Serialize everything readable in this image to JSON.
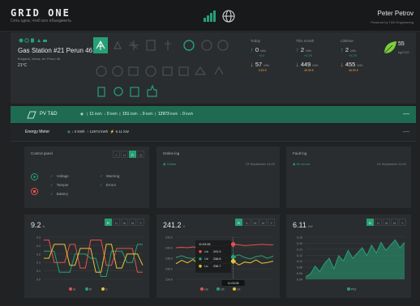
{
  "header": {
    "brand": "GRID ONE",
    "tagline": "Сеть одна, чтоб все объединить",
    "user_name": "Peter Petrov",
    "user_sub": "Powered by T&D Engineering"
  },
  "station": {
    "title": "Gas Station #21 Perun 46",
    "address": "Bulgaria, Varna, str. Perun 46",
    "temperature": "21°C"
  },
  "stats": [
    {
      "label": "Today",
      "in_value": "0",
      "in_unit": "kWh",
      "in_delta": "+0.0",
      "out_value": "57",
      "out_unit": "kWh",
      "out_delta": "5.83 €"
    },
    {
      "label": "This month",
      "in_value": "2",
      "in_unit": "kWh",
      "in_delta": "+0.2 €",
      "out_value": "449",
      "out_unit": "kWh",
      "out_delta": "45.95 €"
    },
    {
      "label": "Lifetime",
      "in_value": "2",
      "in_unit": "kWh",
      "in_delta": "+0.2 €",
      "out_value": "455",
      "out_unit": "kWh",
      "out_delta": "46.53 €"
    }
  ],
  "co2": {
    "value": "55",
    "unit": "kg/CO2"
  },
  "pv": {
    "title": "PV T&D",
    "m1": "11",
    "m1u": "kWh",
    "m2": "0",
    "m2u": "kWh",
    "m3": "151",
    "m3u": "kWh",
    "m4": "0",
    "m4u": "kWh",
    "m5": "12973",
    "m5u": "kWh",
    "m6": "0",
    "m6u": "kWh",
    "minimize": "—"
  },
  "energy_meter": {
    "title": "Energy Meter",
    "m1": "0",
    "m1u": "kWh",
    "m2": "12973",
    "m2u": "kWh",
    "m3": "6.11",
    "m3u": "kW",
    "minimize": "—"
  },
  "control_panel": {
    "title": "Control panel",
    "modes": [
      "I",
      "U",
      "P",
      "Q"
    ],
    "active_mode": "P",
    "checks": [
      "Voltage",
      "Tamper",
      "Battery",
      "Warning",
      "Errors"
    ]
  },
  "online_log": {
    "title": "Online log",
    "status": "Online",
    "date": "23 September 11:02"
  },
  "fault_log": {
    "title": "Fault log",
    "status": "No errors",
    "date": "23 September 11:02"
  },
  "range_buttons": [
    "R",
    "D",
    "W",
    "M",
    "Y"
  ],
  "current_chart": {
    "value": "9.2",
    "unit": "A"
  },
  "voltage_chart": {
    "value": "241.2",
    "unit": "V"
  },
  "power_chart": {
    "value": "6.11",
    "unit": "kW"
  },
  "colors": {
    "accent": "#26a075",
    "red": "#e8504a",
    "yellow": "#e8c43a",
    "orange": "#f0a23a"
  },
  "chart_data": [
    {
      "type": "line",
      "title": "9.2 A",
      "y_ticks": [
        "9.3",
        "9.2",
        "9.2",
        "9.1",
        "9.1",
        "9.0"
      ],
      "ylim": [
        9.0,
        9.3
      ],
      "series": [
        {
          "name": "Ia",
          "color": "#e8504a",
          "values": [
            9.28,
            9.28,
            9.12,
            9.12,
            9.12,
            9.25,
            9.25,
            9.08,
            9.08,
            9.28,
            9.28,
            9.28,
            9.1,
            9.1,
            9.22,
            9.22,
            9.22,
            9.22,
            9.05,
            9.05
          ]
        },
        {
          "name": "Ib",
          "color": "#26a075",
          "values": [
            9.2,
            9.2,
            9.2,
            9.05,
            9.05,
            9.05,
            9.18,
            9.18,
            9.18,
            9.15,
            9.15,
            9.02,
            9.02,
            9.2,
            9.2,
            9.2,
            9.12,
            9.12,
            9.25,
            9.25
          ]
        },
        {
          "name": "Ic",
          "color": "#e8c43a",
          "values": [
            9.15,
            9.15,
            9.25,
            9.25,
            9.25,
            9.1,
            9.1,
            9.22,
            9.22,
            9.22,
            9.05,
            9.05,
            9.25,
            9.25,
            9.08,
            9.08,
            9.18,
            9.18,
            9.18,
            9.1
          ]
        }
      ]
    },
    {
      "type": "line",
      "title": "241.2 V",
      "y_ticks": [
        "242.0",
        "240.0",
        "238.0",
        "236.0",
        "234.0"
      ],
      "ylim": [
        233.0,
        243.0
      ],
      "series": [
        {
          "name": "Ua",
          "color": "#e8504a",
          "values": [
            240.5,
            240.6,
            240.5,
            240.7,
            240.5,
            240.6,
            240.8,
            241.0,
            240.9,
            241.2,
            241.3,
            241.2,
            241.0,
            241.1,
            241.2,
            241.3,
            241.2,
            241.2
          ]
        },
        {
          "name": "Ub",
          "color": "#26a075",
          "values": [
            238.2,
            238.6,
            238.1,
            237.9,
            238.5,
            238.4,
            238.0,
            238.9,
            238.6,
            238.1,
            238.3,
            238.8,
            238.2,
            237.8,
            238.4,
            238.6,
            238.0,
            238.5
          ]
        },
        {
          "name": "Uc",
          "color": "#e8c43a",
          "values": [
            236.7,
            237.5,
            236.9,
            237.7,
            236.5,
            237.2,
            236.8,
            237.6,
            236.9,
            236.7,
            237.3,
            236.4,
            237.1,
            236.9,
            237.6,
            236.8,
            237.0,
            237.3
          ]
        }
      ],
      "tooltip": {
        "time": "11:03:28",
        "rows": [
          {
            "name": "Ua",
            "value": "241.0",
            "color": "#e8504a"
          },
          {
            "name": "Ub",
            "value": "238.8",
            "color": "#26a075"
          },
          {
            "name": "Uc",
            "value": "236.7",
            "color": "#e8c43a"
          }
        ]
      },
      "cursor_label": "11:03:28"
    },
    {
      "type": "area",
      "title": "6.11 kW",
      "y_ticks": [
        "6.18",
        "6.16",
        "6.14",
        "6.12",
        "6.10",
        "6.08",
        "6.06",
        "6.04"
      ],
      "ylim": [
        6.03,
        6.19
      ],
      "series": [
        {
          "name": "Ptot",
          "color": "#26a075",
          "values": [
            6.04,
            6.05,
            6.08,
            6.06,
            6.09,
            6.11,
            6.07,
            6.12,
            6.1,
            6.14,
            6.11,
            6.13,
            6.15,
            6.12,
            6.16,
            6.13,
            6.17,
            6.14,
            6.16,
            6.18,
            6.15,
            6.17
          ]
        }
      ]
    }
  ]
}
